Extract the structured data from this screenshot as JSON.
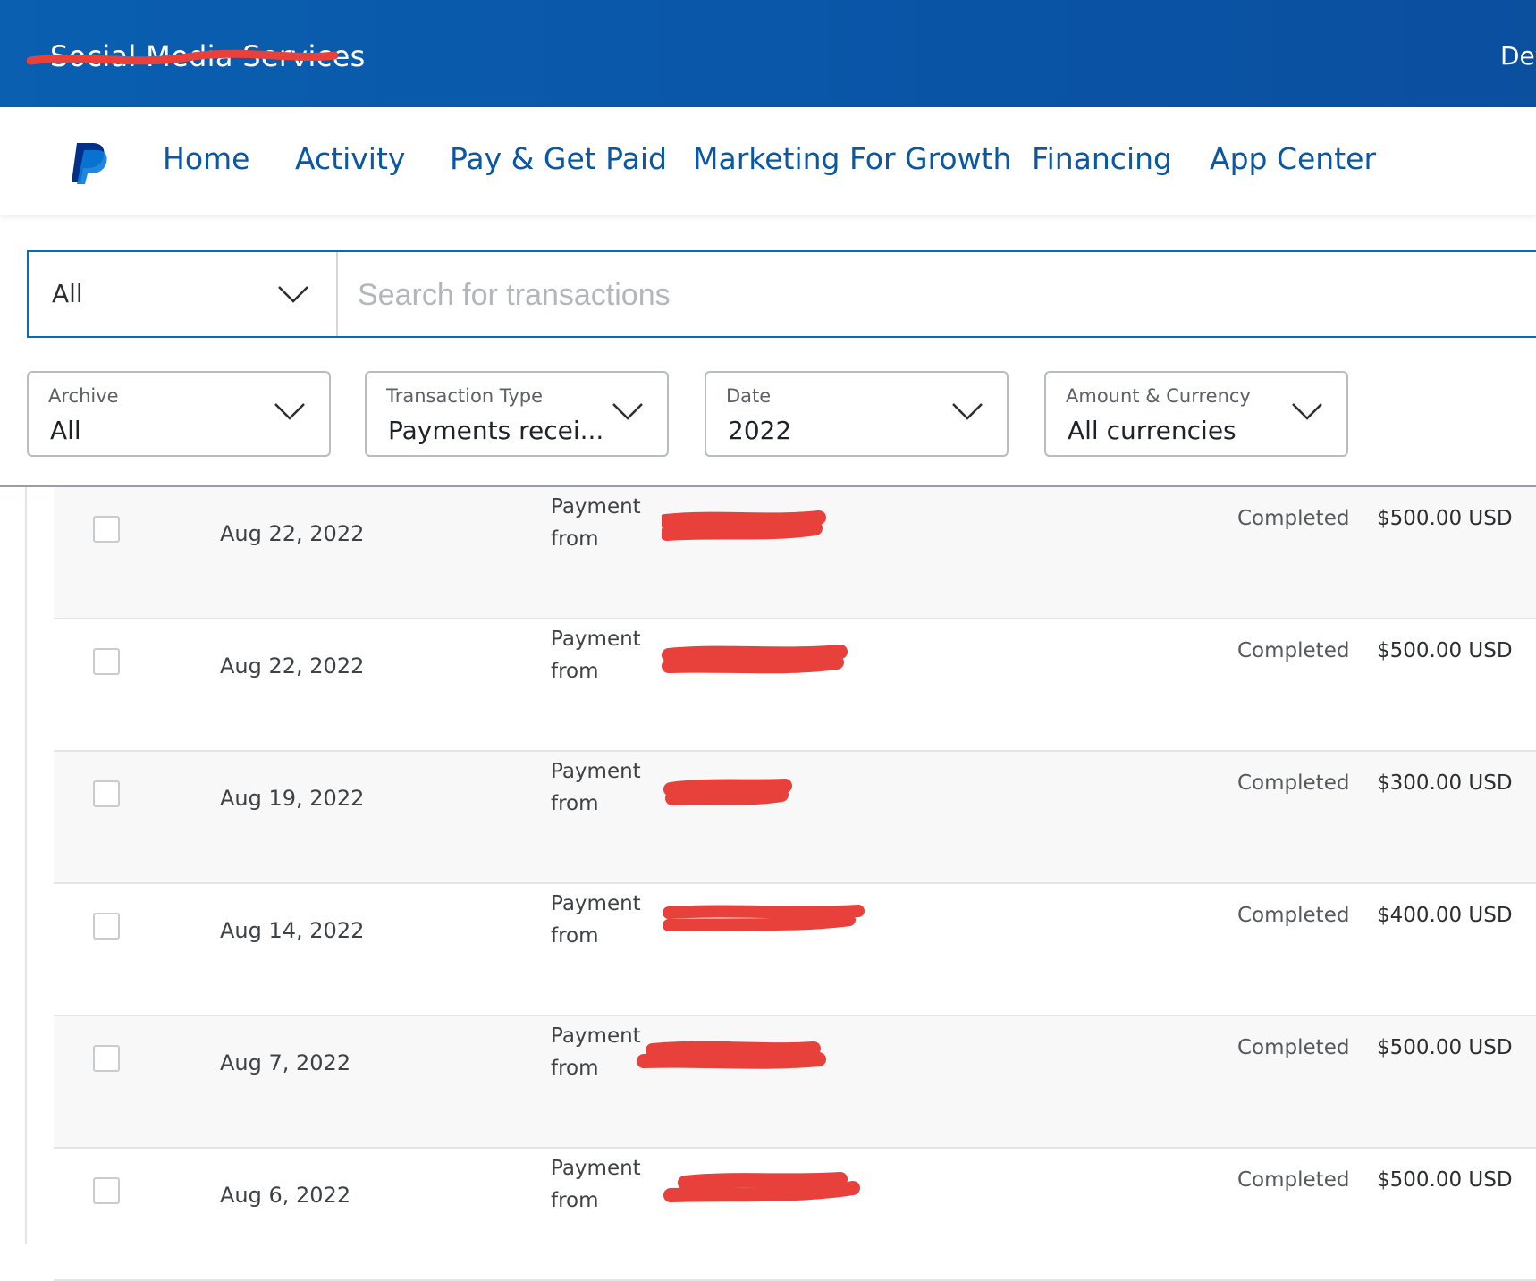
{
  "header": {
    "business_name": "Social Media Services",
    "right_text": "Dev"
  },
  "nav": {
    "items": [
      {
        "label": "Home"
      },
      {
        "label": "Activity"
      },
      {
        "label": "Pay & Get Paid"
      },
      {
        "label": "Marketing For Growth"
      },
      {
        "label": "Financing"
      },
      {
        "label": "App Center"
      }
    ]
  },
  "search": {
    "scope_value": "All",
    "placeholder": "Search for transactions"
  },
  "filters": [
    {
      "label": "Archive",
      "value": "All"
    },
    {
      "label": "Transaction Type",
      "value": "Payments recei..."
    },
    {
      "label": "Date",
      "value": "2022"
    },
    {
      "label": "Amount & Currency",
      "value": "All currencies"
    }
  ],
  "transactions": [
    {
      "date": "Aug 22, 2022",
      "type": "Payment from",
      "status": "Completed",
      "amount": "$500.00 USD"
    },
    {
      "date": "Aug 22, 2022",
      "type": "Payment from",
      "status": "Completed",
      "amount": "$500.00 USD"
    },
    {
      "date": "Aug 19, 2022",
      "type": "Payment from",
      "status": "Completed",
      "amount": "$300.00 USD"
    },
    {
      "date": "Aug 14, 2022",
      "type": "Payment from",
      "status": "Completed",
      "amount": "$400.00 USD"
    },
    {
      "date": "Aug 7, 2022",
      "type": "Payment from",
      "status": "Completed",
      "amount": "$500.00 USD"
    },
    {
      "date": "Aug 6, 2022",
      "type": "Payment from",
      "status": "Completed",
      "amount": "$500.00 USD"
    }
  ],
  "colors": {
    "header_blue": "#0a5fb0",
    "nav_link": "#0a57a4",
    "redaction": "#e8403a"
  }
}
